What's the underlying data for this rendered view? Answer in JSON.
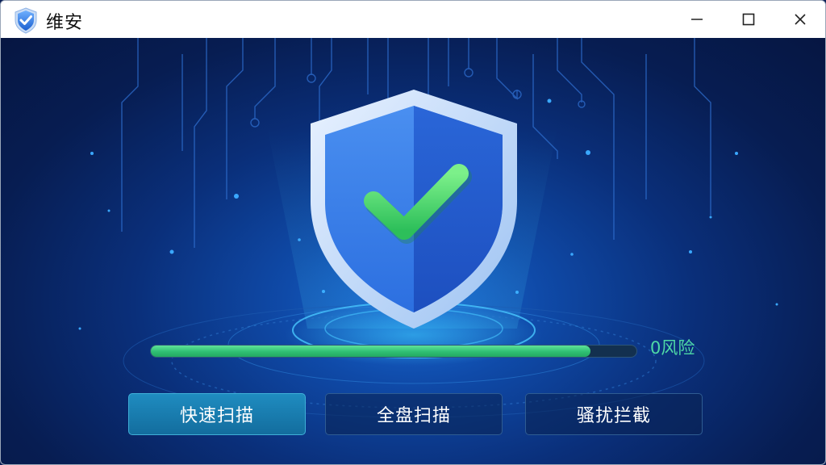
{
  "window": {
    "title": "维安",
    "controls": [
      "minimize",
      "maximize",
      "close"
    ]
  },
  "status": {
    "risk_label": "0风险",
    "progress_fraction": 0.905
  },
  "actions": [
    {
      "label": "快速扫描",
      "active": true
    },
    {
      "label": "全盘扫描",
      "active": false
    },
    {
      "label": "骚扰拦截",
      "active": false
    }
  ],
  "icons": {
    "app_logo": "shield-check-icon",
    "hero": "shield-check-icon"
  },
  "colors": {
    "accent_green": "#2fbf73",
    "risk_text": "#4fd9a6",
    "active_button": "#1f8cc0",
    "background_dark": "#071d52"
  }
}
